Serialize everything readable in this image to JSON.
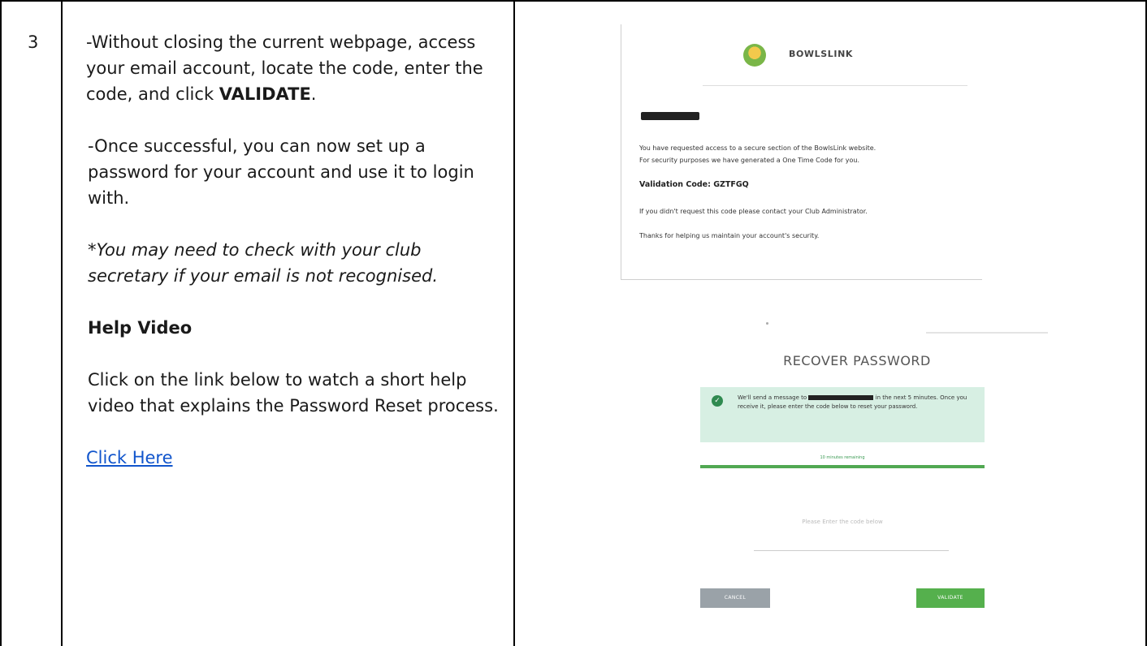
{
  "row_number": "3",
  "instructions": {
    "line1_pre": "-Without closing the current webpage, access your email account, locate the code, enter the code, and click",
    "line1_bold": "VALIDATE",
    "line1_post": ".",
    "p2": "-Once successful, you can now set up a password for your account and use it to login with.",
    "note": "*You may need to check with your club secretary if your email is not recognised.",
    "help_heading": "Help Video",
    "help_text": "Click on the link below to watch a short help video that explains the Password Reset process.",
    "link": "Click Here"
  },
  "email": {
    "brand": "BOWLSLINK",
    "body1": "You have requested access to a secure section of the BowlsLink website.",
    "body2": "For security purposes we have generated a One Time Code for you.",
    "code": "Validation Code: GZTFGQ",
    "body3": "If you didn't request this code please contact your Club Administrator.",
    "body4": "Thanks for helping us maintain your account's security."
  },
  "recover": {
    "title": "RECOVER PASSWORD",
    "msg_pre": "We'll send a message to",
    "msg_post": "in the next 5 minutes. Once you receive it, please enter the code below to reset your password.",
    "remaining": "10 minutes remaining",
    "progress": 1.0,
    "hint": "Please Enter the code below",
    "cancel": "CANCEL",
    "validate": "VALIDATE"
  },
  "colors": {
    "link": "#1155cc",
    "validate": "#55b04d",
    "cancel": "#9aa2a8",
    "msgbox": "#d7efe3"
  }
}
